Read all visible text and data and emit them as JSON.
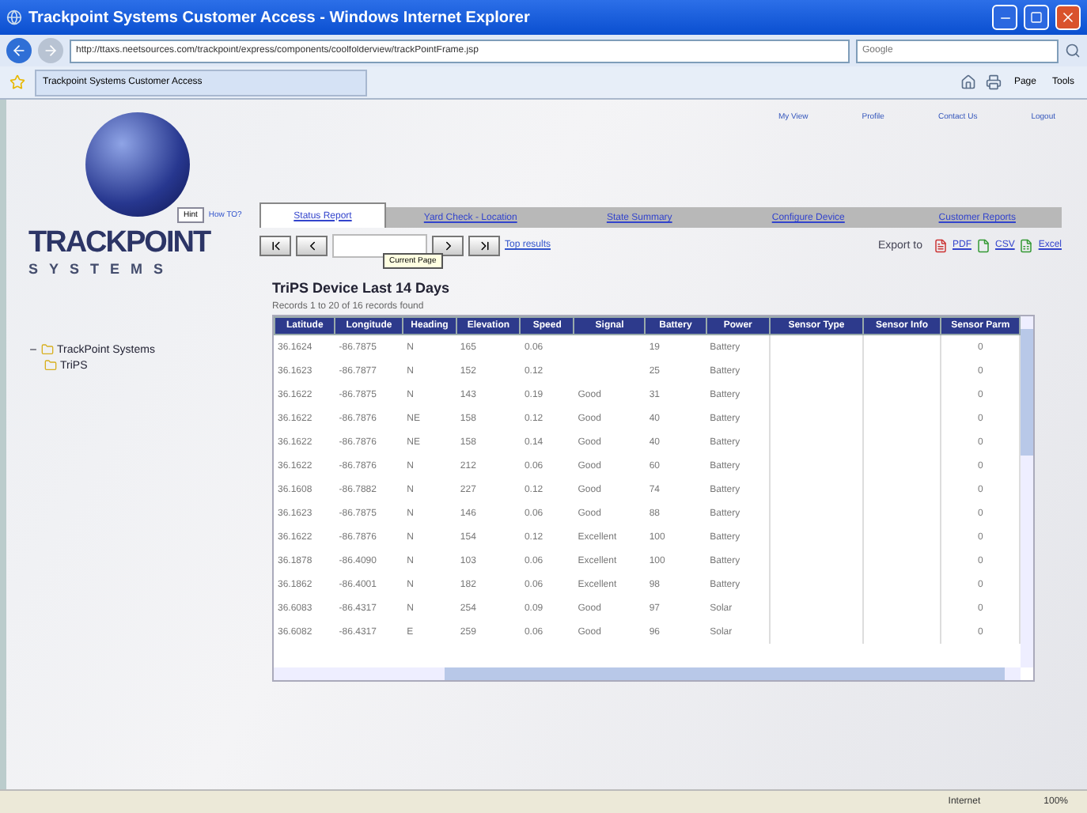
{
  "window": {
    "title": "Trackpoint Systems Customer Access - Windows Internet Explorer"
  },
  "address_bar": {
    "url": "http://ttaxs.neetsources.com/trackpoint/express/components/coolfolderview/trackPointFrame.jsp",
    "search_placeholder": "Google"
  },
  "favorites_tab": {
    "label": "Trackpoint Systems Customer Access"
  },
  "command_bar": [
    "Page",
    "Tools"
  ],
  "top_links": [
    "My View",
    "Profile",
    "Contact Us",
    "Logout"
  ],
  "logo": {
    "name": "TRACKPOINT",
    "tagline": "SYSTEMS"
  },
  "help": {
    "button": "Hint",
    "link": "How TO?"
  },
  "tabs": [
    {
      "label": "Status Report",
      "selected": true
    },
    {
      "label": "Yard Check - Location",
      "selected": false
    },
    {
      "label": "State Summary",
      "selected": false
    },
    {
      "label": "Configure Device",
      "selected": false
    },
    {
      "label": "Customer Reports",
      "selected": false
    }
  ],
  "pager": {
    "tooltip": "Current Page",
    "top_results": "Top results"
  },
  "export": {
    "label": "Export to",
    "formats": [
      "PDF",
      "CSV",
      "Excel"
    ]
  },
  "tree": {
    "label": "TrackPoint Systems",
    "expanded": true,
    "children": [
      {
        "label": "TriPS"
      }
    ]
  },
  "report": {
    "title": "TriPS Device Last 14 Days",
    "records": "Records 1 to 20 of 16 records found",
    "columns": [
      "Latitude",
      "Longitude",
      "Heading",
      "Elevation",
      "Speed",
      "Signal",
      "Battery",
      "Power",
      "Sensor Type",
      "Sensor Info",
      "Sensor Parm"
    ],
    "rows": [
      [
        "36.1624",
        "-86.7875",
        "N",
        "165",
        "0.06",
        "",
        "19",
        "Battery",
        "",
        "",
        "0"
      ],
      [
        "36.1623",
        "-86.7877",
        "N",
        "152",
        "0.12",
        "",
        "25",
        "Battery",
        "",
        "",
        "0"
      ],
      [
        "36.1622",
        "-86.7875",
        "N",
        "143",
        "0.19",
        "Good",
        "31",
        "Battery",
        "",
        "",
        "0"
      ],
      [
        "36.1622",
        "-86.7876",
        "NE",
        "158",
        "0.12",
        "Good",
        "40",
        "Battery",
        "",
        "",
        "0"
      ],
      [
        "36.1622",
        "-86.7876",
        "NE",
        "158",
        "0.14",
        "Good",
        "40",
        "Battery",
        "",
        "",
        "0"
      ],
      [
        "36.1622",
        "-86.7876",
        "N",
        "212",
        "0.06",
        "Good",
        "60",
        "Battery",
        "",
        "",
        "0"
      ],
      [
        "36.1608",
        "-86.7882",
        "N",
        "227",
        "0.12",
        "Good",
        "74",
        "Battery",
        "",
        "",
        "0"
      ],
      [
        "36.1623",
        "-86.7875",
        "N",
        "146",
        "0.06",
        "Good",
        "88",
        "Battery",
        "",
        "",
        "0"
      ],
      [
        "36.1622",
        "-86.7876",
        "N",
        "154",
        "0.12",
        "Excellent",
        "100",
        "Battery",
        "",
        "",
        "0"
      ],
      [
        "36.1878",
        "-86.4090",
        "N",
        "103",
        "0.06",
        "Excellent",
        "100",
        "Battery",
        "",
        "",
        "0"
      ],
      [
        "36.1862",
        "-86.4001",
        "N",
        "182",
        "0.06",
        "Excellent",
        "98",
        "Battery",
        "",
        "",
        "0"
      ],
      [
        "36.6083",
        "-86.4317",
        "N",
        "254",
        "0.09",
        "Good",
        "97",
        "Solar",
        "",
        "",
        "0"
      ],
      [
        "36.6082",
        "-86.4317",
        "E",
        "259",
        "0.06",
        "Good",
        "96",
        "Solar",
        "",
        "",
        "0"
      ]
    ]
  },
  "status_bar": {
    "zone": "Internet",
    "zoom": "100%"
  }
}
